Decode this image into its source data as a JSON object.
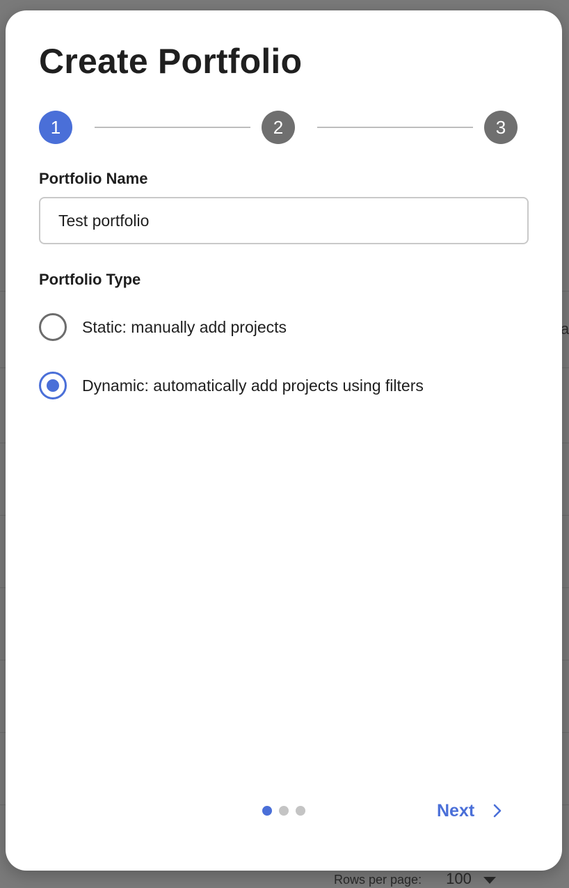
{
  "background": {
    "rows_per_page_label": "Rows per page:",
    "rows_per_page_value": "100",
    "edge_text": "a"
  },
  "modal": {
    "title": "Create Portfolio",
    "steps": [
      "1",
      "2",
      "3"
    ],
    "active_step": 1,
    "portfolio_name": {
      "label": "Portfolio Name",
      "value": "Test portfolio"
    },
    "portfolio_type": {
      "label": "Portfolio Type",
      "options": [
        {
          "label": "Static: manually add projects",
          "selected": false
        },
        {
          "label": "Dynamic: automatically add projects using filters",
          "selected": true
        }
      ]
    },
    "pagination": {
      "current": 1,
      "total": 3
    },
    "next_label": "Next",
    "next_icon": "chevron-right-icon"
  },
  "colors": {
    "accent": "#4a6fd8",
    "step_inactive": "#6f6f6f",
    "overlay": "#7a7a7a"
  }
}
